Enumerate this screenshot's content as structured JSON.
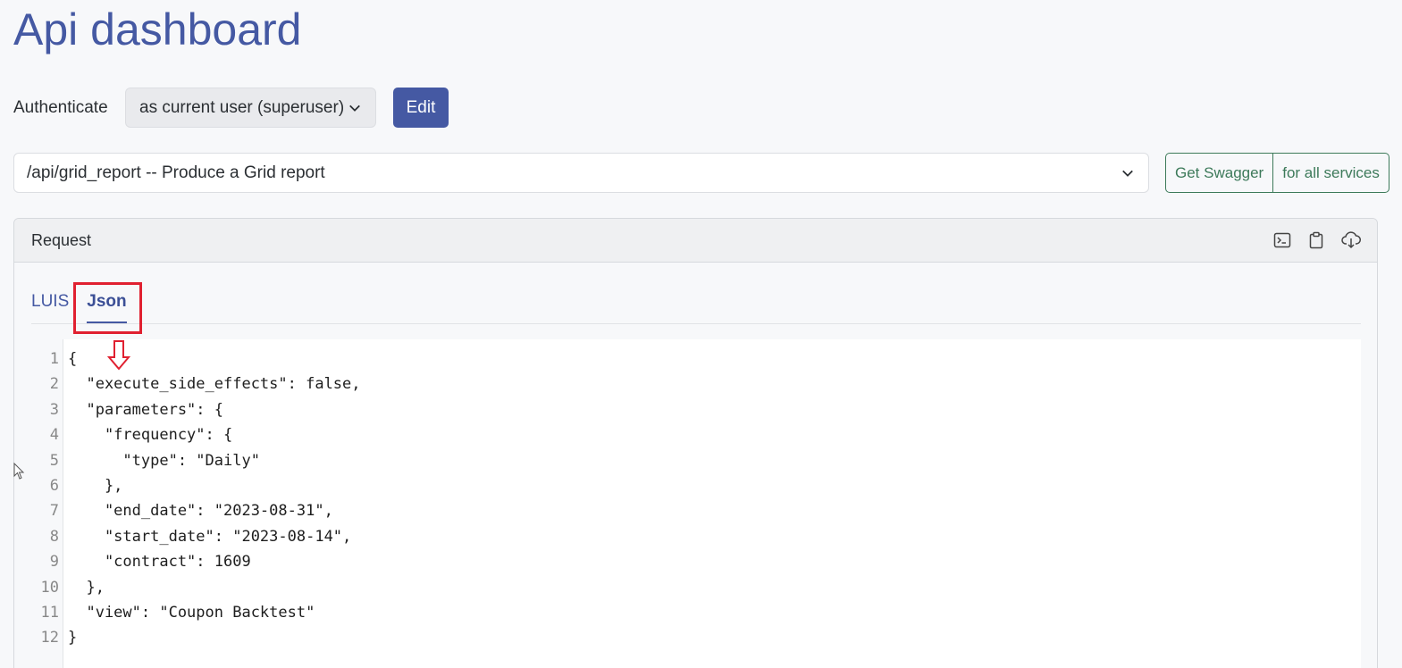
{
  "page": {
    "title": "Api dashboard"
  },
  "auth": {
    "label": "Authenticate",
    "selected": "as current user (superuser)",
    "edit_label": "Edit"
  },
  "endpoint": {
    "selected": "/api/grid_report -- Produce a Grid report"
  },
  "swagger": {
    "get_label": "Get Swagger",
    "all_label": "for all services"
  },
  "request": {
    "title": "Request",
    "icons": [
      "terminal-icon",
      "clipboard-icon",
      "cloud-download-icon"
    ],
    "tabs": [
      {
        "label": "LUIS",
        "active": false
      },
      {
        "label": "Json",
        "active": true
      }
    ],
    "line_numbers": [
      "1",
      "2",
      "3",
      "4",
      "5",
      "6",
      "7",
      "8",
      "9",
      "10",
      "11",
      "12"
    ],
    "code_lines": [
      "{",
      "  \"execute_side_effects\": false,",
      "  \"parameters\": {",
      "    \"frequency\": {",
      "      \"type\": \"Daily\"",
      "    },",
      "    \"end_date\": \"2023-08-31\",",
      "    \"start_date\": \"2023-08-14\",",
      "    \"contract\": 1609",
      "  },",
      "  \"view\": \"Coupon Backtest\"",
      "}"
    ]
  },
  "colors": {
    "brand": "#4559a3",
    "success_outline": "#3d7a5a",
    "annotation": "#e02030"
  }
}
